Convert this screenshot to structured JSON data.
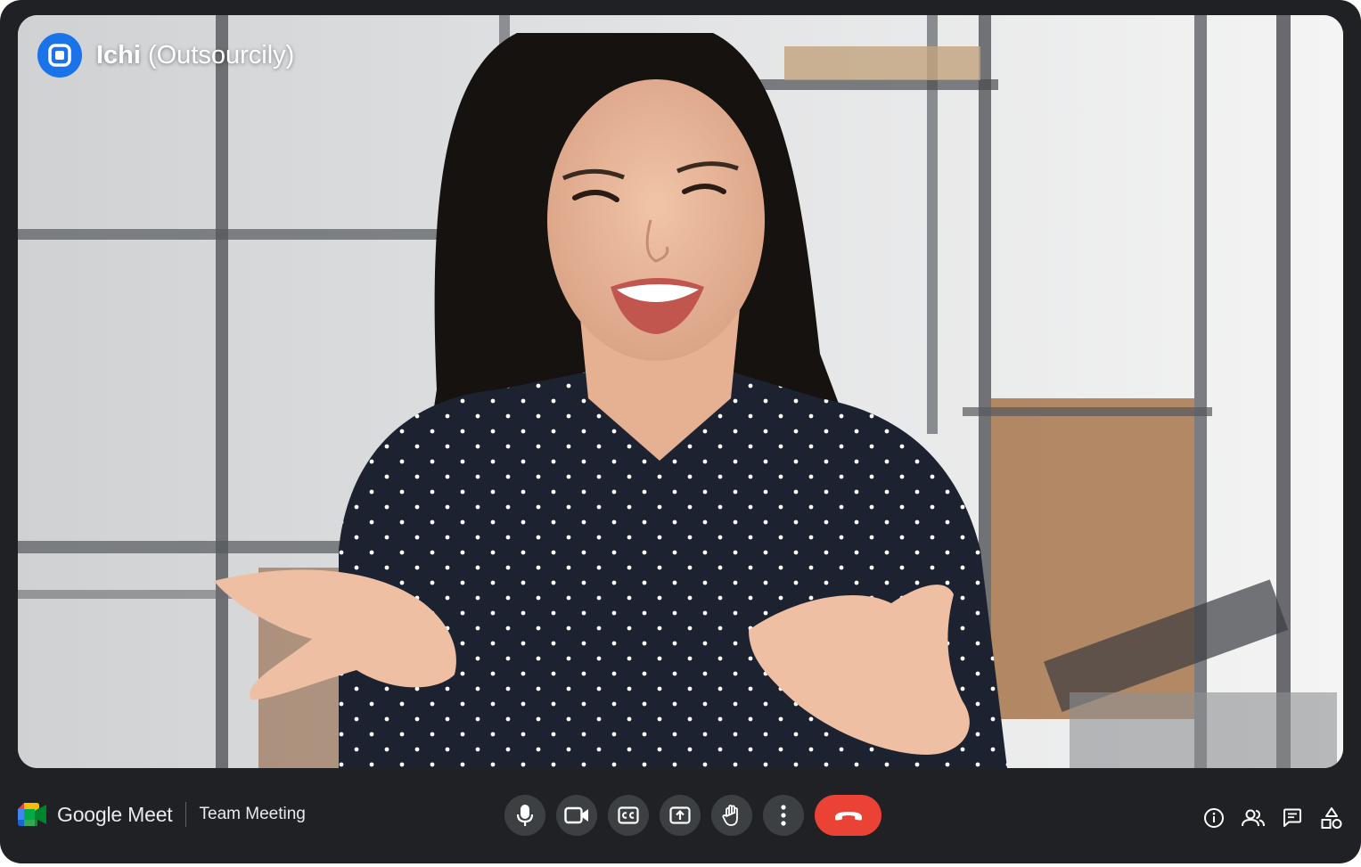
{
  "participant": {
    "first_name": "Ichi",
    "organization": "(Outsourcily)",
    "avatar_icon": "square-logo-icon",
    "avatar_color": "#1a73e8"
  },
  "brand": {
    "app_name": "Google Meet",
    "meeting_title": "Team Meeting"
  },
  "controls": [
    {
      "name": "microphone",
      "icon": "microphone-icon"
    },
    {
      "name": "camera",
      "icon": "video-camera-icon"
    },
    {
      "name": "captions",
      "icon": "closed-captions-icon"
    },
    {
      "name": "present",
      "icon": "present-screen-icon"
    },
    {
      "name": "raise-hand",
      "icon": "hand-icon"
    },
    {
      "name": "more-options",
      "icon": "more-vertical-icon"
    },
    {
      "name": "leave-call",
      "icon": "phone-hangup-icon"
    }
  ],
  "side_tools": [
    {
      "name": "meeting-details",
      "icon": "info-icon"
    },
    {
      "name": "people",
      "icon": "people-icon"
    },
    {
      "name": "chat",
      "icon": "chat-icon"
    },
    {
      "name": "activities",
      "icon": "shapes-icon"
    }
  ],
  "colors": {
    "background": "#202124",
    "button": "#3c4043",
    "end_call": "#ea4335",
    "text": "#e8eaed"
  }
}
